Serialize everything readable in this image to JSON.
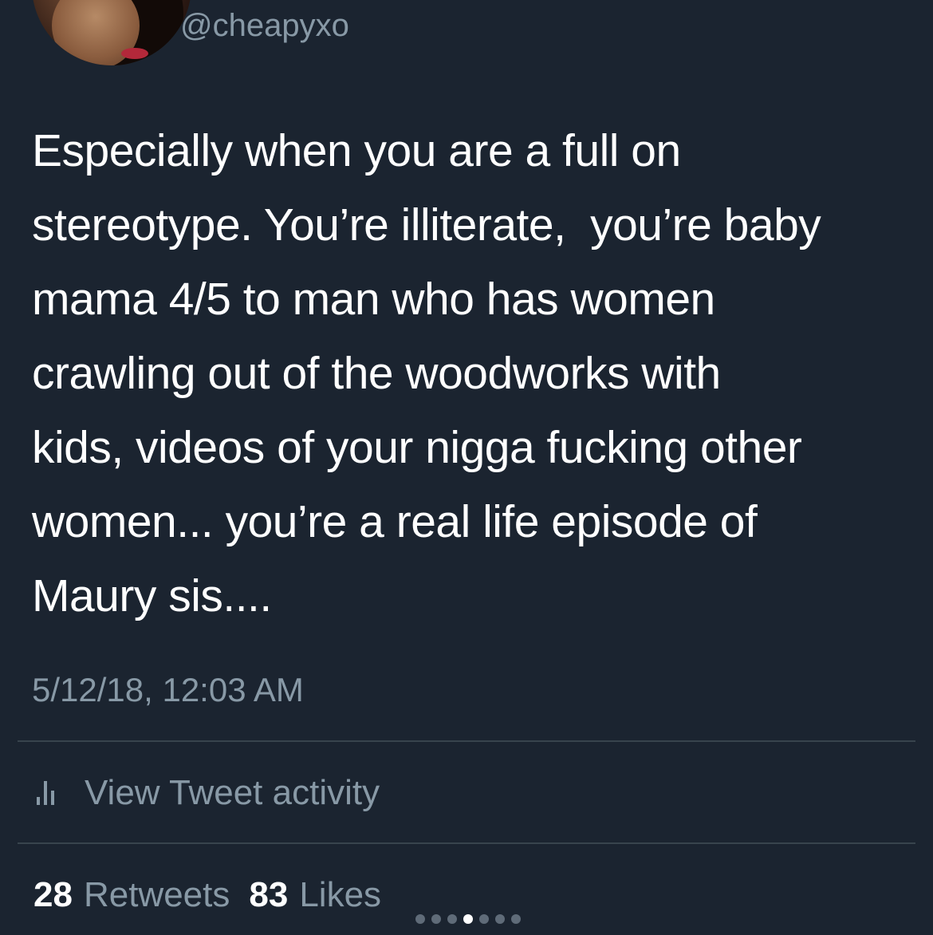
{
  "author": {
    "handle": "@cheapyxo"
  },
  "tweet": {
    "text": "Especially when you are a full on\nstereotype. You’re illiterate,  you’re baby\nmama 4/5 to man who has women\ncrawling out of the woodworks with\nkids, videos of your nigga fucking other\nwomen... you’re a real life episode of\nMaury sis....",
    "timestamp": "5/12/18, 12:03 AM"
  },
  "activity": {
    "icon": "bar-chart-icon",
    "label": "View Tweet activity"
  },
  "stats": {
    "retweets_count": "28",
    "retweets_label": "Retweets",
    "likes_count": "83",
    "likes_label": "Likes"
  },
  "carousel": {
    "total_dots": 7,
    "active_index": 3
  },
  "colors": {
    "background": "#1b2430",
    "primary_text": "#ffffff",
    "secondary_text": "#8899a6",
    "divider": "#38444d"
  }
}
